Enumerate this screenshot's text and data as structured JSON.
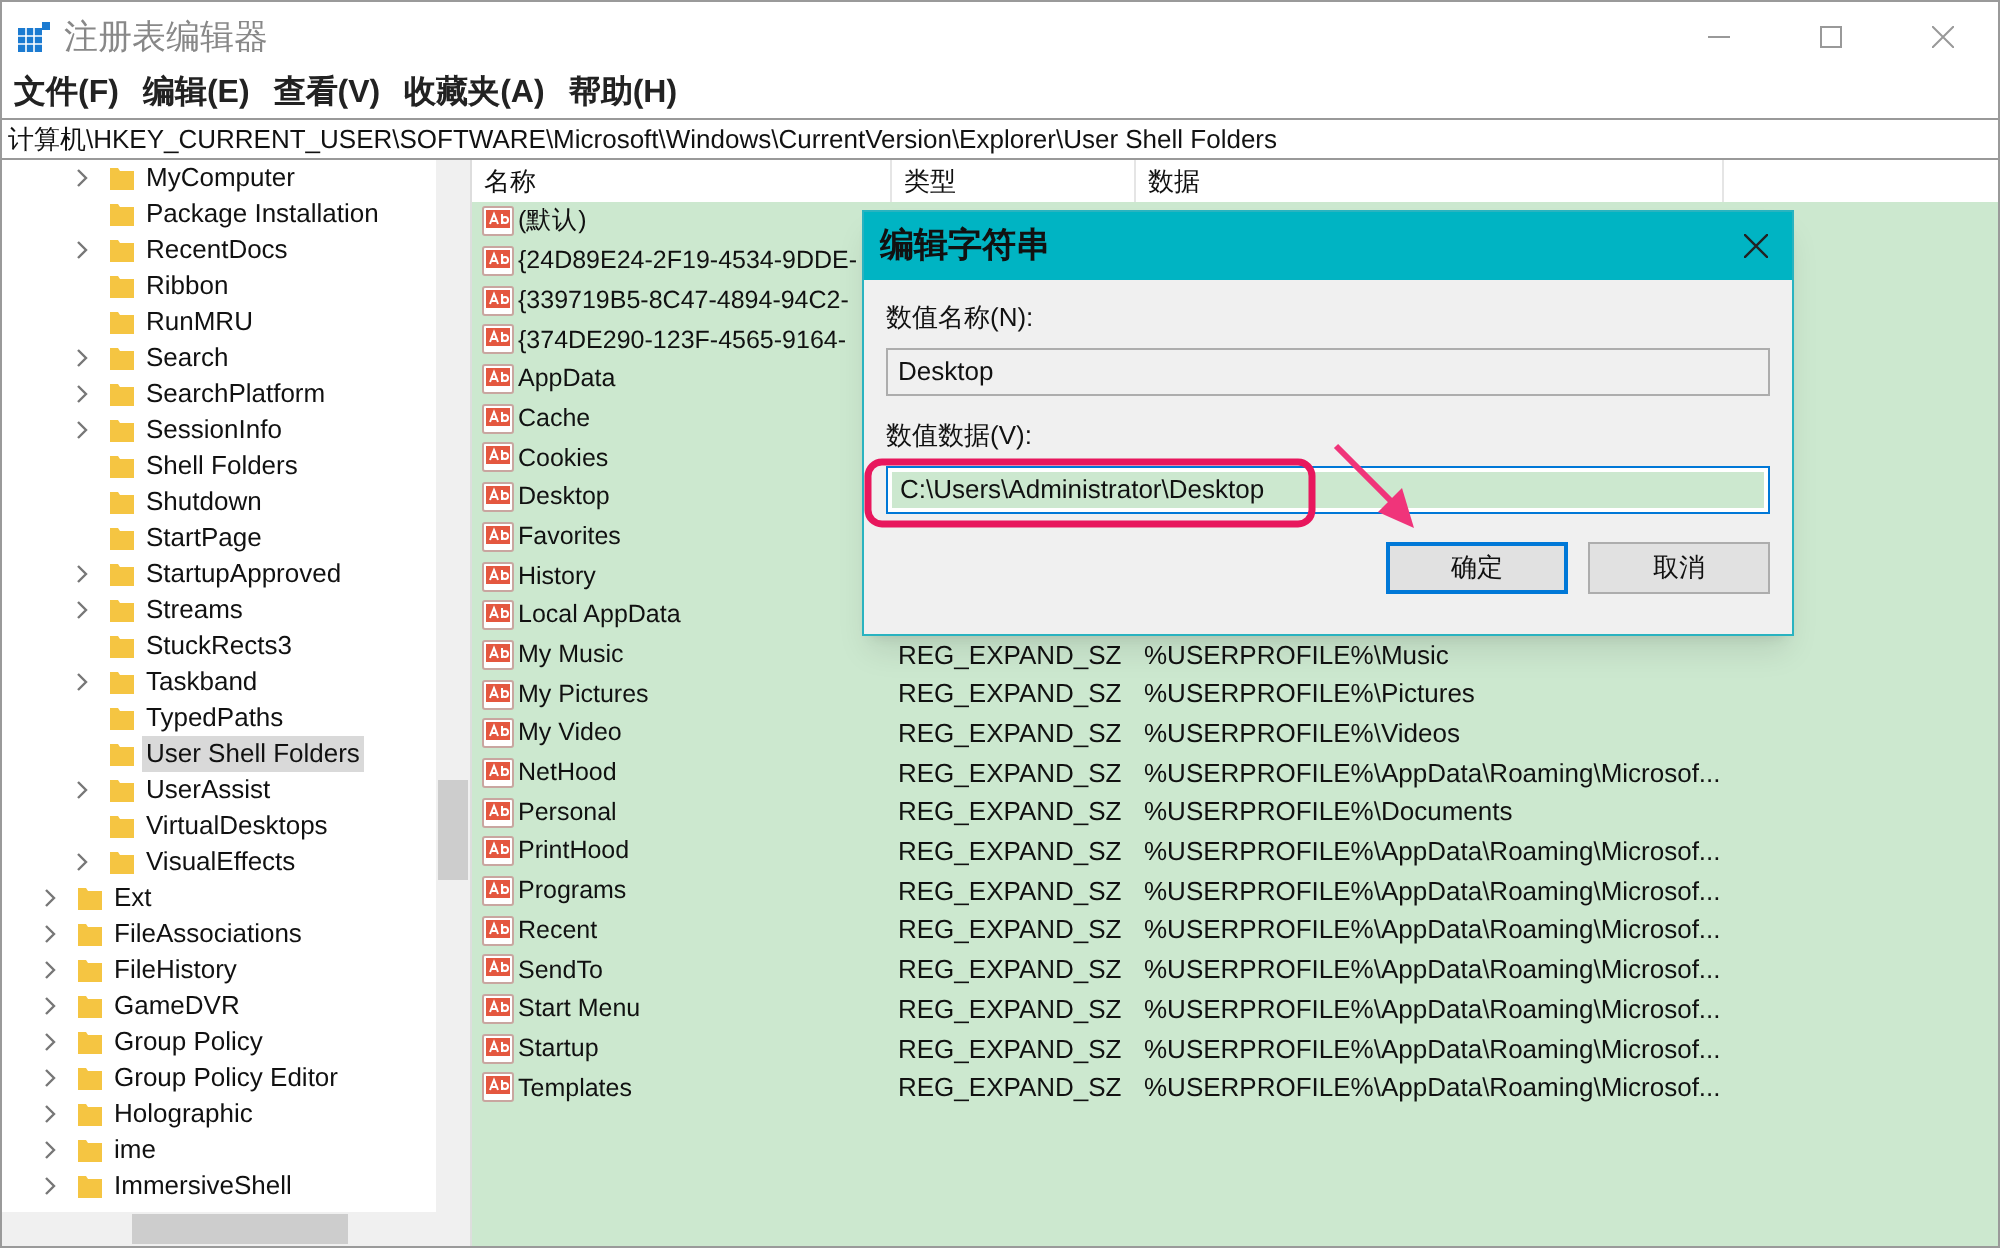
{
  "window": {
    "title": "注册表编辑器"
  },
  "menu": [
    "文件(F)",
    "编辑(E)",
    "查看(V)",
    "收藏夹(A)",
    "帮助(H)"
  ],
  "address": "计算机\\HKEY_CURRENT_USER\\SOFTWARE\\Microsoft\\Windows\\CurrentVersion\\Explorer\\User Shell Folders",
  "tree": {
    "scrolled_parent_children": [
      {
        "label": "MyComputer",
        "expandable": true,
        "selected": false
      },
      {
        "label": "Package Installation",
        "expandable": false,
        "selected": false
      },
      {
        "label": "RecentDocs",
        "expandable": true,
        "selected": false
      },
      {
        "label": "Ribbon",
        "expandable": false,
        "selected": false
      },
      {
        "label": "RunMRU",
        "expandable": false,
        "selected": false
      },
      {
        "label": "Search",
        "expandable": true,
        "selected": false
      },
      {
        "label": "SearchPlatform",
        "expandable": true,
        "selected": false
      },
      {
        "label": "SessionInfo",
        "expandable": true,
        "selected": false
      },
      {
        "label": "Shell Folders",
        "expandable": false,
        "selected": false
      },
      {
        "label": "Shutdown",
        "expandable": false,
        "selected": false
      },
      {
        "label": "StartPage",
        "expandable": false,
        "selected": false
      },
      {
        "label": "StartupApproved",
        "expandable": true,
        "selected": false
      },
      {
        "label": "Streams",
        "expandable": true,
        "selected": false
      },
      {
        "label": "StuckRects3",
        "expandable": false,
        "selected": false
      },
      {
        "label": "Taskband",
        "expandable": true,
        "selected": false
      },
      {
        "label": "TypedPaths",
        "expandable": false,
        "selected": false
      },
      {
        "label": "User Shell Folders",
        "expandable": false,
        "selected": true
      },
      {
        "label": "UserAssist",
        "expandable": true,
        "selected": false
      },
      {
        "label": "VirtualDesktops",
        "expandable": false,
        "selected": false
      },
      {
        "label": "VisualEffects",
        "expandable": true,
        "selected": false
      }
    ],
    "items": [
      {
        "label": "Ext",
        "expandable": true,
        "selected": false
      },
      {
        "label": "FileAssociations",
        "expandable": true,
        "selected": false
      },
      {
        "label": "FileHistory",
        "expandable": true,
        "selected": false
      },
      {
        "label": "GameDVR",
        "expandable": true,
        "selected": false
      },
      {
        "label": "Group Policy",
        "expandable": true,
        "selected": false
      },
      {
        "label": "Group Policy Editor",
        "expandable": true,
        "selected": false
      },
      {
        "label": "Holographic",
        "expandable": true,
        "selected": false
      },
      {
        "label": "ime",
        "expandable": true,
        "selected": false
      },
      {
        "label": "ImmersiveShell",
        "expandable": true,
        "selected": false
      }
    ]
  },
  "table": {
    "columns": [
      "名称",
      "类型",
      "数据"
    ],
    "rows": [
      {
        "name": "(默认)"
      },
      {
        "name": "{24D89E24-2F19-4534-9DDE-"
      },
      {
        "name": "{339719B5-8C47-4894-94C2-"
      },
      {
        "name": "{374DE290-123F-4565-9164-"
      },
      {
        "name": "AppData"
      },
      {
        "name": "Cache"
      },
      {
        "name": "Cookies"
      },
      {
        "name": "Desktop"
      },
      {
        "name": "Favorites"
      },
      {
        "name": "History"
      },
      {
        "name": "Local AppData"
      },
      {
        "name": "My Music",
        "type": "REG_EXPAND_SZ",
        "data": "%USERPROFILE%\\Music"
      },
      {
        "name": "My Pictures",
        "type": "REG_EXPAND_SZ",
        "data": "%USERPROFILE%\\Pictures"
      },
      {
        "name": "My Video",
        "type": "REG_EXPAND_SZ",
        "data": "%USERPROFILE%\\Videos"
      },
      {
        "name": "NetHood",
        "type": "REG_EXPAND_SZ",
        "data": "%USERPROFILE%\\AppData\\Roaming\\Microsof..."
      },
      {
        "name": "Personal",
        "type": "REG_EXPAND_SZ",
        "data": "%USERPROFILE%\\Documents"
      },
      {
        "name": "PrintHood",
        "type": "REG_EXPAND_SZ",
        "data": "%USERPROFILE%\\AppData\\Roaming\\Microsof..."
      },
      {
        "name": "Programs",
        "type": "REG_EXPAND_SZ",
        "data": "%USERPROFILE%\\AppData\\Roaming\\Microsof..."
      },
      {
        "name": "Recent",
        "type": "REG_EXPAND_SZ",
        "data": "%USERPROFILE%\\AppData\\Roaming\\Microsof..."
      },
      {
        "name": "SendTo",
        "type": "REG_EXPAND_SZ",
        "data": "%USERPROFILE%\\AppData\\Roaming\\Microsof..."
      },
      {
        "name": "Start Menu",
        "type": "REG_EXPAND_SZ",
        "data": "%USERPROFILE%\\AppData\\Roaming\\Microsof..."
      },
      {
        "name": "Startup",
        "type": "REG_EXPAND_SZ",
        "data": "%USERPROFILE%\\AppData\\Roaming\\Microsof..."
      },
      {
        "name": "Templates",
        "type": "REG_EXPAND_SZ",
        "data": "%USERPROFILE%\\AppData\\Roaming\\Microsof..."
      }
    ]
  },
  "dialog": {
    "title": "编辑字符串",
    "name_label": "数值名称(N):",
    "name_value": "Desktop",
    "data_label": "数值数据(V):",
    "data_value": "C:\\Users\\Administrator\\Desktop",
    "buttons": [
      "确定",
      "取消"
    ]
  }
}
